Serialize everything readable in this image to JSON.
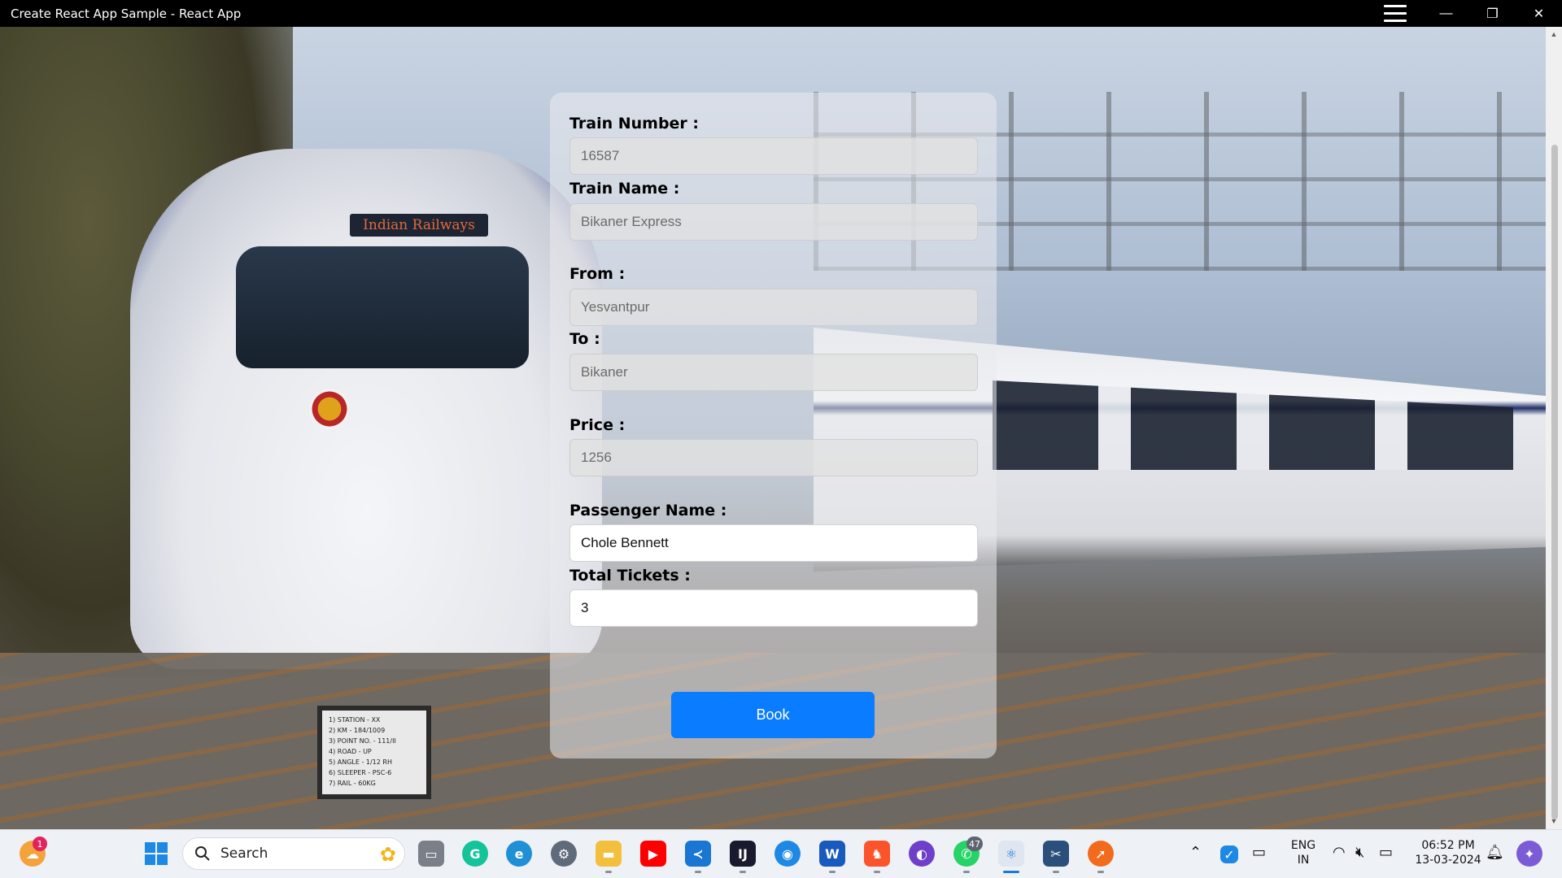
{
  "window": {
    "title": "Create React App Sample - React App",
    "minimize": "—",
    "restore": "❐",
    "close": "✕"
  },
  "background": {
    "sign_text": "Indian Railways",
    "signpost_lines": [
      "1) STATION  - XX",
      "2) KM  - 184/1009",
      "3) POINT NO.  - 111/II",
      "4) ROAD  - UP",
      "5) ANGLE  - 1/12 RH",
      "6) SLEEPER  - PSC-6",
      "7) RAIL  - 60KG"
    ]
  },
  "form": {
    "train_number": {
      "label": "Train Number :",
      "value": "16587"
    },
    "train_name": {
      "label": "Train Name :",
      "value": "Bikaner Express"
    },
    "from": {
      "label": "From :",
      "value": "Yesvantpur"
    },
    "to": {
      "label": "To :",
      "value": "Bikaner"
    },
    "price": {
      "label": "Price :",
      "value": "1256"
    },
    "passenger_name": {
      "label": "Passenger Name :",
      "value": "Chole Bennett"
    },
    "total_tickets": {
      "label": "Total Tickets :",
      "value": "3"
    },
    "book_label": "Book"
  },
  "taskbar": {
    "search_label": "Search",
    "weather_badge": "1",
    "whatsapp_badge": "47",
    "language_line1": "ENG",
    "language_line2": "IN",
    "time": "06:52 PM",
    "date": "13-03-2024",
    "colors": {
      "accent": "#0a7cff",
      "windows_blue": "#1e88e5",
      "youtube_red": "#ff0000",
      "brave_orange": "#fb542b",
      "whatsapp_green": "#25d366"
    }
  }
}
